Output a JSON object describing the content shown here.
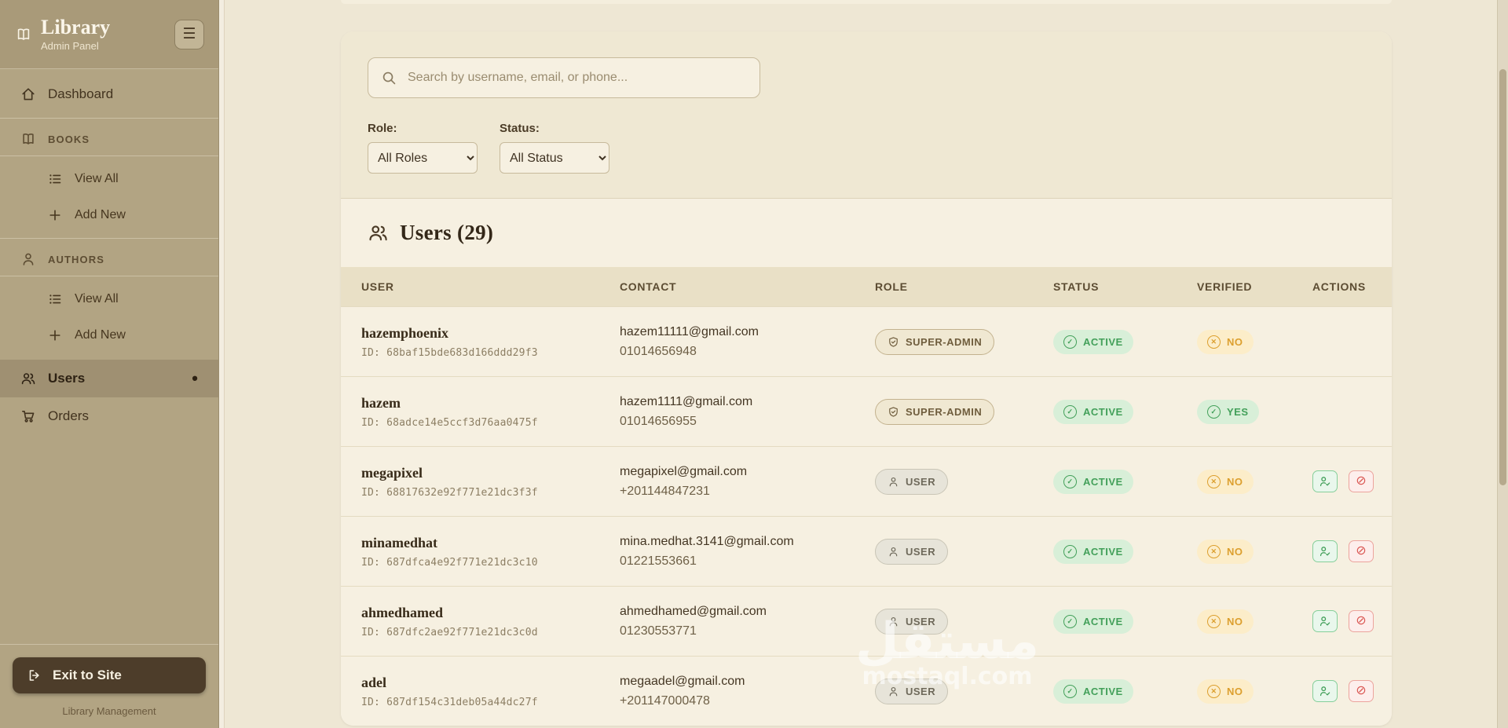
{
  "app": {
    "title": "Library",
    "subtitle": "Admin Panel",
    "footer": "Library Management"
  },
  "icons": {
    "hamburger": "☰",
    "active_dot": "•",
    "check": "✓",
    "cross": "✕",
    "block": "⊘"
  },
  "sidebar": {
    "dashboard": "Dashboard",
    "books_section": "BOOKS",
    "books_view_all": "View All",
    "books_add_new": "Add New",
    "authors_section": "AUTHORS",
    "authors_view_all": "View All",
    "authors_add_new": "Add New",
    "users": "Users",
    "orders": "Orders",
    "exit": "Exit to Site"
  },
  "filters": {
    "search_placeholder": "Search by username, email, or phone...",
    "role_label": "Role:",
    "role_selected": "All Roles",
    "status_label": "Status:",
    "status_selected": "All Status"
  },
  "users": {
    "title": "Users (29)"
  },
  "table": {
    "headers": {
      "user": "USER",
      "contact": "CONTACT",
      "role": "ROLE",
      "status": "STATUS",
      "verified": "VERIFIED",
      "actions": "ACTIONS"
    },
    "rows": [
      {
        "username": "hazemphoenix",
        "user_id": "ID: 68baf15bde683d166ddd29f3",
        "email": "hazem11111@gmail.com",
        "phone": "01014656948",
        "role": "SUPER-ADMIN",
        "status": "ACTIVE",
        "verified": "NO",
        "has_actions": false
      },
      {
        "username": "hazem",
        "user_id": "ID: 68adce14e5ccf3d76aa0475f",
        "email": "hazem1111@gmail.com",
        "phone": "01014656955",
        "role": "SUPER-ADMIN",
        "status": "ACTIVE",
        "verified": "YES",
        "has_actions": false
      },
      {
        "username": "megapixel",
        "user_id": "ID: 68817632e92f771e21dc3f3f",
        "email": "megapixel@gmail.com",
        "phone": "+201144847231",
        "role": "USER",
        "status": "ACTIVE",
        "verified": "NO",
        "has_actions": true
      },
      {
        "username": "minamedhat",
        "user_id": "ID: 687dfca4e92f771e21dc3c10",
        "email": "mina.medhat.3141@gmail.com",
        "phone": "01221553661",
        "role": "USER",
        "status": "ACTIVE",
        "verified": "NO",
        "has_actions": true
      },
      {
        "username": "ahmedhamed",
        "user_id": "ID: 687dfc2ae92f771e21dc3c0d",
        "email": "ahmedhamed@gmail.com",
        "phone": "01230553771",
        "role": "USER",
        "status": "ACTIVE",
        "verified": "NO",
        "has_actions": true
      },
      {
        "username": "adel",
        "user_id": "ID: 687df154c31deb05a44dc27f",
        "email": "megaadel@gmail.com",
        "phone": "+201147000478",
        "role": "USER",
        "status": "ACTIVE",
        "verified": "NO",
        "has_actions": true
      }
    ]
  },
  "watermark": {
    "arabic": "مستقل",
    "latin": "mostaql.com"
  },
  "colors": {
    "sidebar_bg": "#b2a483",
    "main_bg": "#eee7d4",
    "accent_dark": "#4d3d2a",
    "active_green": "#43a05a",
    "warn_orange": "#dc9f2e",
    "danger_red": "#d9534f"
  }
}
